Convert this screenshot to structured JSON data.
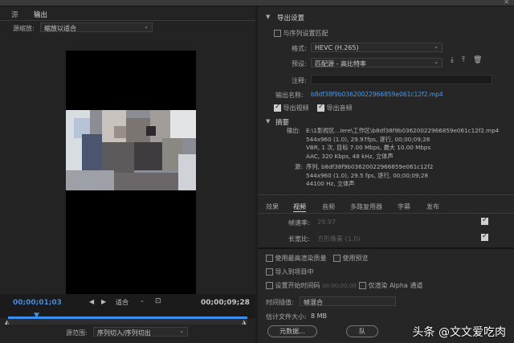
{
  "window": {
    "title": "导出设置"
  },
  "left": {
    "tabs": [
      {
        "label": "源"
      },
      {
        "label": "输出"
      }
    ],
    "scale": {
      "label": "源缩放:",
      "value": "缩放以适合"
    },
    "timecode_start": "00;00;01;03",
    "timecode_end": "00;00;09;28",
    "fit": {
      "value": "适合"
    },
    "source_range": {
      "label": "源范围:",
      "value": "序列切入/序列切出"
    }
  },
  "export": {
    "section": "导出设置",
    "match_sequence": "与序列设置匹配",
    "format": {
      "label": "格式:",
      "value": "HEVC (H.265)"
    },
    "preset": {
      "label": "预设:",
      "value": "匹配源 - 高比特率"
    },
    "comment": {
      "label": "注释:"
    },
    "output_name": {
      "label": "输出名称:",
      "value": "b8df38f9b03620022966859e061c12f2.mp4"
    },
    "export_video": "导出视频",
    "export_audio": "导出音频",
    "summary": {
      "title": "摘要",
      "output_label": "输出:",
      "output_lines": [
        "E:\\1影视区...iere\\工作区\\b8df38f9b03620022966859e061c12f2.mp4",
        "544x960 (1.0), 29.97fps, 逐行, 00;00;09;28",
        "VBR, 1 次, 目标 7.00 Mbps, 最大 10.00 Mbps",
        "AAC, 320 Kbps, 48 kHz, 立体声"
      ],
      "source_label": "源:",
      "source_lines": [
        "序列, b8df38f9b03620022966859e061c12f2",
        "544x960 (1.0), 29.5 fps, 逐行, 00;00;09;28",
        "44100 Hz, 立体声"
      ]
    }
  },
  "tabs2": [
    {
      "label": "效果"
    },
    {
      "label": "视频"
    },
    {
      "label": "音频"
    },
    {
      "label": "多路复用器"
    },
    {
      "label": "字幕"
    },
    {
      "label": "发布"
    }
  ],
  "video_settings": {
    "frame_rate": {
      "label": "帧速率:",
      "value": "29.97"
    },
    "aspect": {
      "label": "长宽比:",
      "value": "方形像素 (1.0)"
    }
  },
  "options": {
    "max_render": "使用最高渲染质量",
    "use_preview": "使用预览",
    "import_project": "导入到项目中",
    "start_timecode": "设置开始时间码",
    "start_timecode_value": "00;00;00;00",
    "alpha_only": "仅渲染 Alpha 通道",
    "interp": {
      "label": "时间插值:",
      "value": "帧混合"
    },
    "file_size": {
      "label": "估计文件大小:",
      "value": "8 MB"
    },
    "metadata_button": "元数据...",
    "queue_button": "队"
  },
  "watermark": "头条 @文文爱吃肉",
  "colors": {
    "accent": "#3d8ee8",
    "panel": "#262626",
    "bg": "#1e1e1e"
  }
}
